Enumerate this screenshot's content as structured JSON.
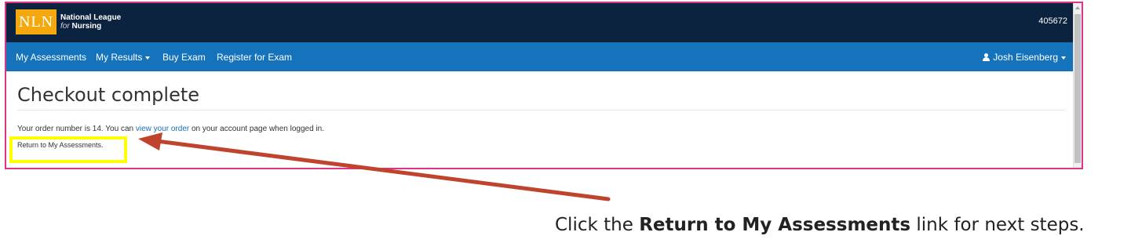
{
  "header": {
    "logo_mark": "NLN",
    "logo_line1": "National League",
    "logo_line2_prefix": "for",
    "logo_line2_word": "Nursing",
    "user_id": "405672"
  },
  "nav": {
    "items": [
      "My Assessments",
      "My Results",
      "Buy Exam",
      "Register for Exam"
    ],
    "user_name": "Josh Eisenberg"
  },
  "main": {
    "title": "Checkout complete",
    "order_text_before": "Your order number is 14. You can ",
    "order_link": "view your order",
    "order_text_after": " on your account page when logged in.",
    "return_link": "Return to My Assessments."
  },
  "annotation": {
    "instruction_before": "Click the ",
    "instruction_bold": "Return to My Assessments",
    "instruction_after": " link for next steps.",
    "highlight_color": "#ffff00",
    "arrow_color": "#c0432e",
    "frame_color": "#e0338a"
  },
  "colors": {
    "topbar": "#0c2340",
    "navbar": "#1473ba",
    "logo_gold": "#f5a80d"
  }
}
